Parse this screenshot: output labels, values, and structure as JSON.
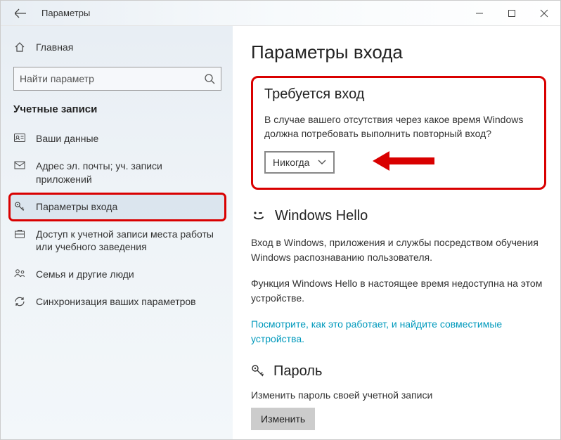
{
  "titlebar": {
    "title": "Параметры"
  },
  "sidebar": {
    "home": "Главная",
    "search_placeholder": "Найти параметр",
    "section": "Учетные записи",
    "items": [
      {
        "label": "Ваши данные"
      },
      {
        "label": "Адрес эл. почты; уч. записи приложений"
      },
      {
        "label": "Параметры входа"
      },
      {
        "label": "Доступ к учетной записи места работы или учебного заведения"
      },
      {
        "label": "Семья и другие люди"
      },
      {
        "label": "Синхронизация ваших параметров"
      }
    ]
  },
  "content": {
    "title": "Параметры входа",
    "require": {
      "heading": "Требуется вход",
      "text": "В случае вашего отсутствия через какое время Windows должна потребовать выполнить повторный вход?",
      "selected": "Никогда"
    },
    "hello": {
      "heading": "Windows Hello",
      "p1": "Вход в Windows, приложения и службы посредством обучения Windows распознаванию пользователя.",
      "p2": "Функция Windows Hello в настоящее время недоступна на этом устройстве.",
      "link": "Посмотрите, как это работает, и найдите совместимые устройства."
    },
    "password": {
      "heading": "Пароль",
      "text": "Изменить пароль своей учетной записи",
      "button": "Изменить"
    }
  }
}
